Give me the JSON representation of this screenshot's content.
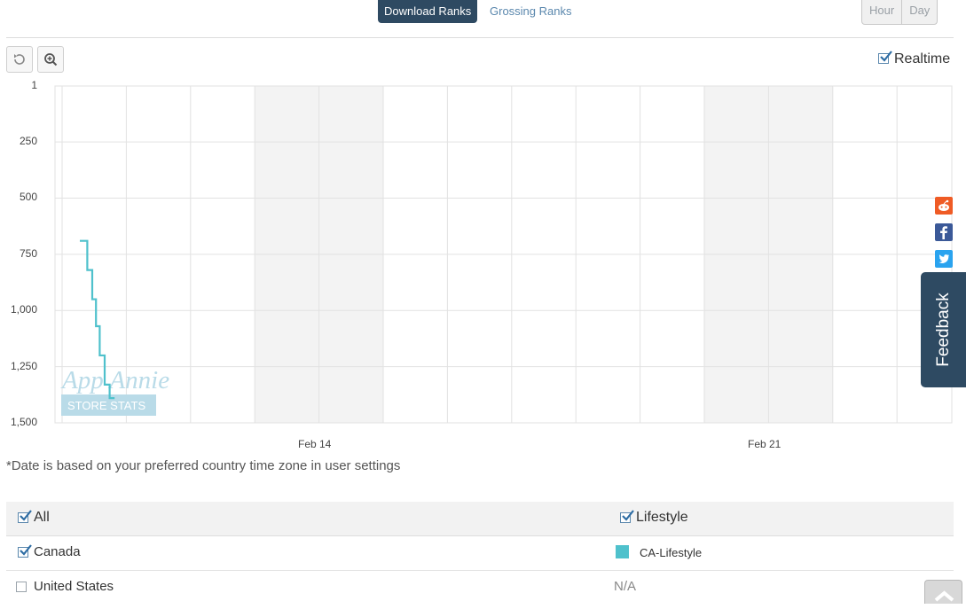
{
  "tabs": {
    "download": "Download Ranks",
    "grossing": "Grossing Ranks"
  },
  "granularity": [
    "Hour",
    "Day"
  ],
  "realtime": {
    "label": "Realtime",
    "checked": true
  },
  "chart_data": {
    "type": "line",
    "y_axis": {
      "reversed": true,
      "range": [
        1,
        1500
      ],
      "ticks": [
        "1",
        "250",
        "500",
        "750",
        "1,000",
        "1,250",
        "1,500"
      ]
    },
    "x_axis": {
      "tick_labels": [
        "Feb 14",
        "Feb 21"
      ]
    },
    "watermark": {
      "line1": "App Annie",
      "line2": "STORE STATS"
    },
    "series": [
      {
        "name": "CA-Lifestyle",
        "color": "#4fc1cc",
        "points": [
          [
            0.0,
            690
          ],
          [
            0.6,
            690
          ],
          [
            0.6,
            820
          ],
          [
            1.0,
            820
          ],
          [
            1.0,
            950
          ],
          [
            1.3,
            950
          ],
          [
            1.3,
            1070
          ],
          [
            1.6,
            1070
          ],
          [
            1.6,
            1200
          ],
          [
            2.0,
            1200
          ],
          [
            2.0,
            1330
          ],
          [
            2.4,
            1330
          ],
          [
            2.4,
            1390
          ],
          [
            2.8,
            1390
          ]
        ]
      }
    ],
    "grid": true
  },
  "note": "*Date is based on your preferred country time zone in user settings",
  "table": {
    "header": {
      "left": "All",
      "right": "Lifestyle"
    },
    "rows": [
      {
        "country": "Canada",
        "checked": true,
        "series_label": "CA-Lifestyle",
        "swatch": "#4fc1cc"
      },
      {
        "country": "United States",
        "checked": false,
        "value": "N/A"
      }
    ]
  },
  "feedback": "Feedback",
  "colors": {
    "accent": "#2e4a62",
    "link": "#5a87ad",
    "reddit": "#ef5b25",
    "facebook": "#3b5998",
    "twitter": "#2aa3ef"
  }
}
